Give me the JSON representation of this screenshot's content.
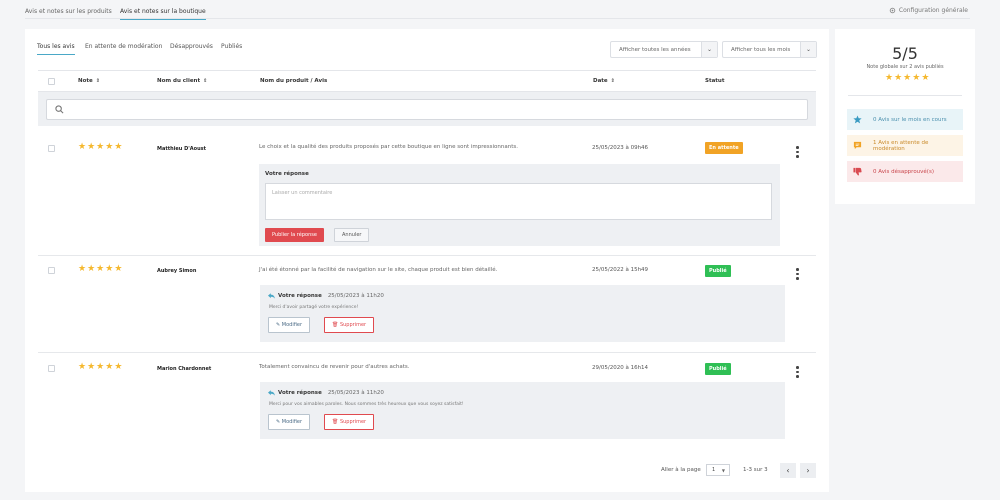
{
  "top_tabs": [
    {
      "label": "Avis et notes sur les produits",
      "active": false
    },
    {
      "label": "Avis et notes sur la boutique",
      "active": true
    }
  ],
  "config_label": "Configuration générale",
  "filter_tabs": [
    "Tous les avis",
    "En attente de modération",
    "Désapprouvés",
    "Publiés"
  ],
  "selects": {
    "years": "Afficher toutes les années",
    "months": "Afficher tous les mois"
  },
  "table": {
    "headers": {
      "rating": "Note",
      "client": "Nom du client",
      "product": "Nom du produit / Avis",
      "date": "Date",
      "status": "Statut"
    },
    "search_placeholder": "",
    "rows": [
      {
        "rating": 5,
        "client": "Matthieu D'Aoust",
        "review": "Le choix et la qualité des produits proposés par cette boutique en ligne sont impressionnants.",
        "date": "25/05/2023 à 09h46",
        "status": "En attente"
      },
      {
        "rating": 5,
        "client": "Aubrey Simon",
        "review": "J'ai été étonné par la facilité de navigation sur le site, chaque produit est bien détaillé.",
        "date": "25/05/2022 à 15h49",
        "status": "Publié"
      },
      {
        "rating": 5,
        "client": "Marion Chardonnet",
        "review": "Totalement convaincu de revenir pour d'autres achats.",
        "date": "29/05/2020 à 16h14",
        "status": "Publié"
      }
    ]
  },
  "reply_form": {
    "label": "Votre réponse",
    "placeholder": "Laisser un commentaire",
    "publish": "Publier la réponse",
    "cancel": "Annuler"
  },
  "replies": [
    {
      "title": "Votre réponse",
      "when": "25/05/2023 à 11h20",
      "message": "Merci d'avoir partagé votre expérience!",
      "edit": "Modifier",
      "delete": "Supprimer"
    },
    {
      "title": "Votre réponse",
      "when": "25/05/2023 à 11h20",
      "message": "Merci pour vos aimables paroles. Nous sommes très heureux que vous soyez satisfait!",
      "edit": "Modifier",
      "delete": "Supprimer"
    }
  ],
  "pagination": {
    "per_page_label": "Aller à la page",
    "page": "1",
    "range": "1-3 sur 3"
  },
  "summary": {
    "score": "5/5",
    "subtitle": "Note globale sur 2 avis publiés",
    "rating": 5,
    "stats": [
      {
        "text": "0 Avis sur le mois en cours",
        "icon": "star-icon"
      },
      {
        "text": "1 Avis en attente de modération",
        "icon": "comment-icon"
      },
      {
        "text": "0 Avis désapprouvé(s)",
        "icon": "thumbs-down-icon"
      }
    ]
  },
  "colors": {
    "accent": "#4aa8c7",
    "star": "#f5b82e",
    "pending": "#f1a325",
    "published": "#2fbf55",
    "danger": "#e04a4f"
  }
}
